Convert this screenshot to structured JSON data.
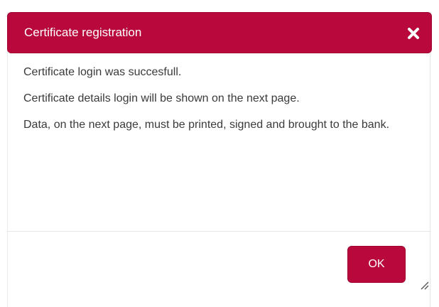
{
  "dialog": {
    "title": "Certificate registration",
    "close_icon": "close-icon",
    "messages": [
      "Certificate login was succesfull.",
      "Certificate details login will be shown on the next page.",
      "Data, on the next page, must be printed, signed and brought to the bank."
    ],
    "ok_label": "OK",
    "resize_icon": "resize-grip-icon"
  },
  "colors": {
    "accent": "#b8083c",
    "text": "#3a3a3a",
    "divider": "#e6e6e6"
  }
}
